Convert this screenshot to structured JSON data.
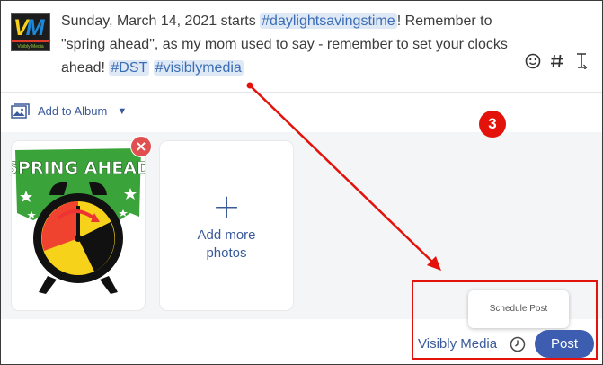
{
  "composer": {
    "avatar_initials": [
      "V",
      "M"
    ],
    "avatar_brand": "Visibly Media",
    "post_segments": [
      {
        "text": "Sunday, March 14, 2021 starts ",
        "tag": false
      },
      {
        "text": "#daylightsavingstime",
        "tag": true
      },
      {
        "text": "! Remember to \"spring ahead\", as my mom used to say - remember to set your clocks ahead! ",
        "tag": false
      },
      {
        "text": "#DST",
        "tag": true
      },
      {
        "text": " ",
        "tag": false
      },
      {
        "text": "#visiblymedia",
        "tag": true
      }
    ],
    "tools": [
      "smiley-icon",
      "hashtag-icon",
      "text-cursor-icon"
    ]
  },
  "album": {
    "label": "Add to Album",
    "icon": "photo-album-icon"
  },
  "media": {
    "image_text": "SPRING AHEAD",
    "add_more_label_line1": "Add more",
    "add_more_label_line2": "photos",
    "remove_symbol": "×"
  },
  "annotation": {
    "step_number": "3",
    "color": "#e3120b"
  },
  "footer": {
    "tooltip": "Schedule Post",
    "account_name": "Visibly Media",
    "post_label": "Post"
  },
  "colors": {
    "accent": "#3c5db0",
    "tag_bg": "#dfe8f5",
    "remove": "#e05050"
  }
}
